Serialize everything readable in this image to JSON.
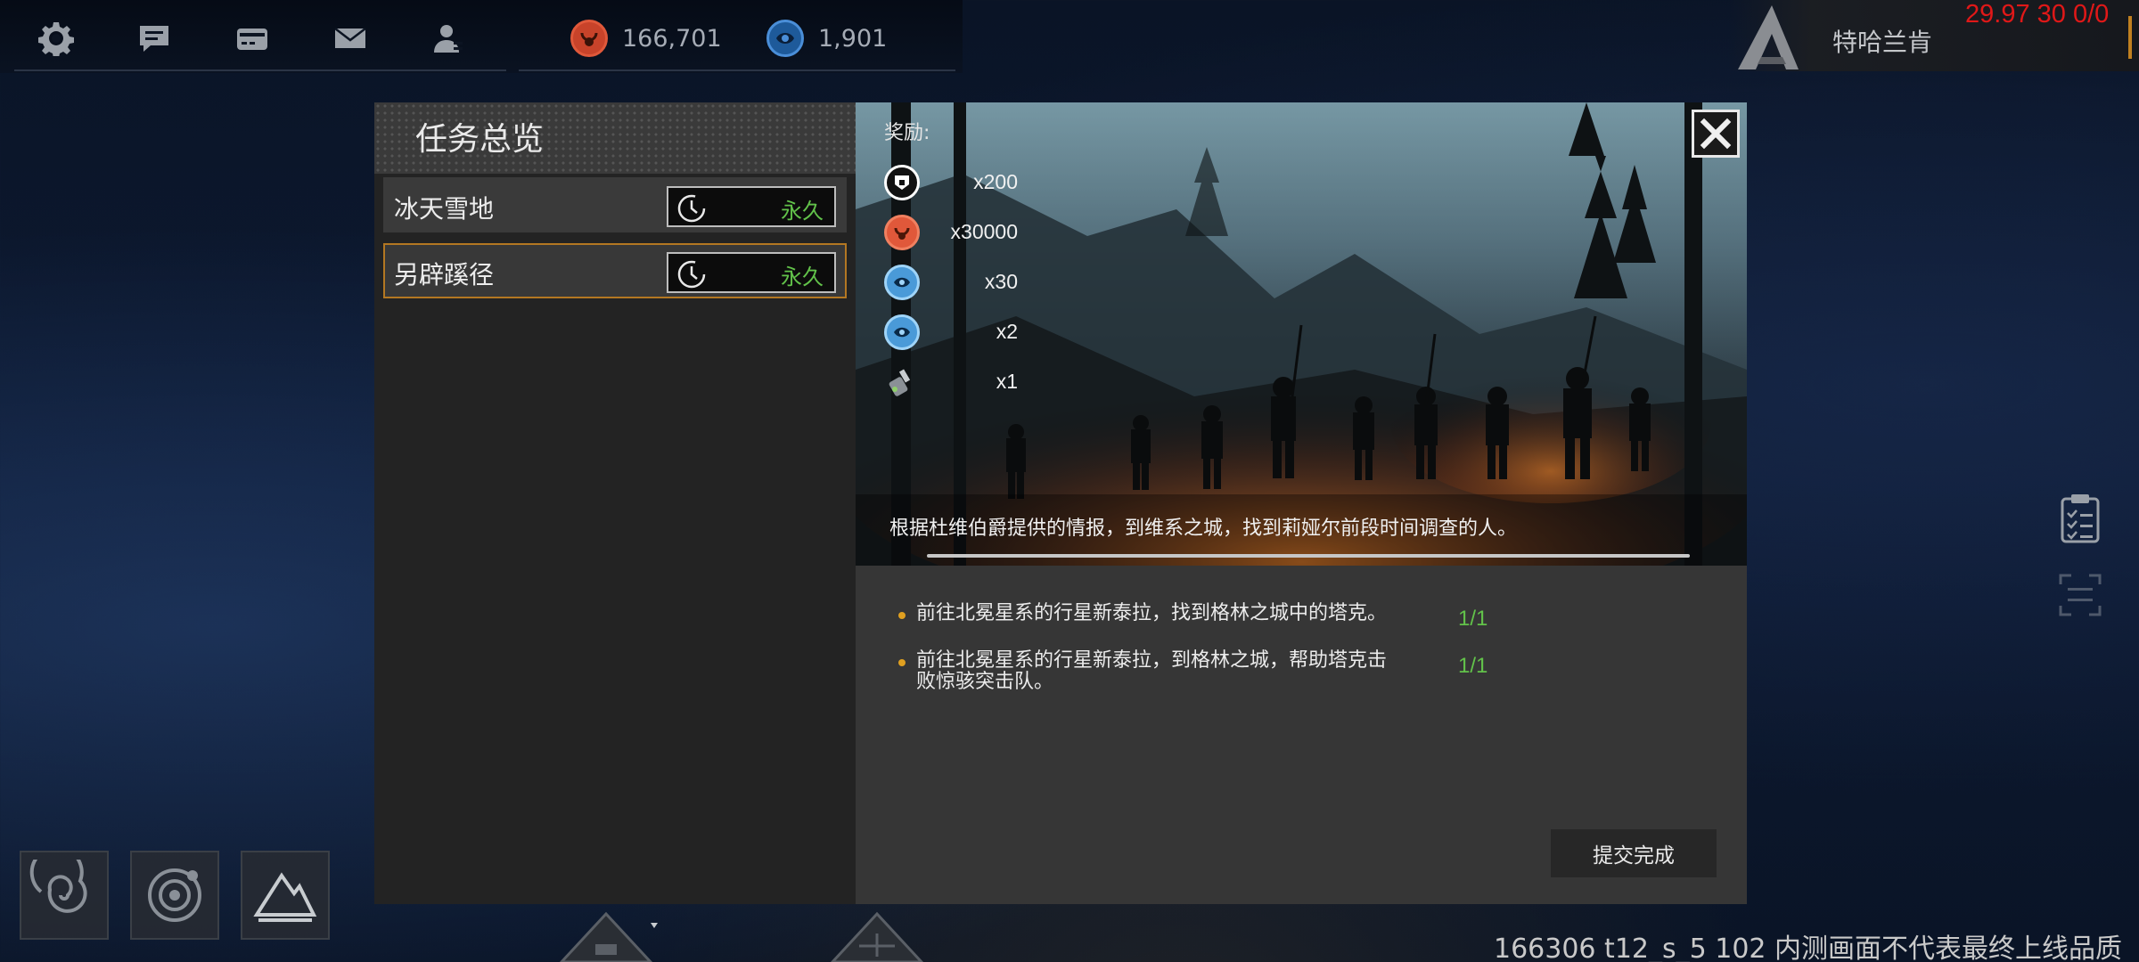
{
  "topbar": {
    "icons": [
      "gear-icon",
      "chat-icon",
      "card-icon",
      "mail-icon",
      "user-icon"
    ],
    "resources": [
      {
        "icon": "credit-coin-icon",
        "value": "166,701",
        "color": "#e0583a"
      },
      {
        "icon": "crystal-coin-icon",
        "value": "1,901",
        "color": "#4a8ed8"
      }
    ]
  },
  "player": {
    "name": "特哈兰肯"
  },
  "fps_overlay": "29.97 30 0/0",
  "quest_panel": {
    "title": "任务总览",
    "quests": [
      {
        "name": "冰天雪地",
        "duration": "永久",
        "selected": false
      },
      {
        "name": "另辟蹊径",
        "duration": "永久",
        "selected": true
      }
    ]
  },
  "rewards": {
    "label": "奖励:",
    "items": [
      {
        "icon": "shield-badge-icon",
        "qty": "x200",
        "color": "#ffffff"
      },
      {
        "icon": "credit-coin-icon",
        "qty": "x30000",
        "color": "#e0583a"
      },
      {
        "icon": "blue-crystal-icon",
        "qty": "x30",
        "color": "#5ab0e8"
      },
      {
        "icon": "blue-crystal-icon",
        "qty": "x2",
        "color": "#5ab0e8"
      },
      {
        "icon": "device-icon",
        "qty": "x1",
        "color": "#8fd06a"
      }
    ]
  },
  "description": "根据杜维伯爵提供的情报，到维系之城，找到莉娅尔前段时间调查的人。",
  "objectives": [
    {
      "text": "前往北冕星系的行星新泰拉，找到格林之城中的塔克。",
      "progress": "1/1"
    },
    {
      "text": "前往北冕星系的行星新泰拉，到格林之城，帮助塔克击败惊骇突击队。",
      "progress": "1/1"
    }
  ],
  "submit_label": "提交完成",
  "bottom_buttons": [
    "galaxy-icon",
    "planet-orbit-icon",
    "mountain-terrain-icon"
  ],
  "watermark": "166306 t12_s_5 102  内测画面不代表最终上线品质"
}
